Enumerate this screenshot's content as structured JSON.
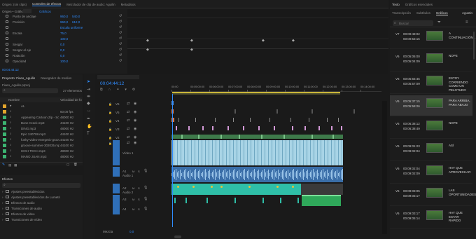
{
  "source_panel": {
    "tabs": [
      "Origen: (sin clips)",
      "Controles de efectos",
      "Mezclador de clip de audio: Aguilin",
      "Metadatos"
    ],
    "active_tab": "Controles de efectos",
    "header": "Origen • Gráficos",
    "subheader": "Gráficos",
    "properties": [
      {
        "name": "Punto de anclaje",
        "v1": "960,0",
        "v2": "540,0"
      },
      {
        "name": "Posición",
        "v1": "960,0",
        "v2": "612,0"
      },
      {
        "name": "",
        "v1": "Escala uniforme",
        "v2": ""
      },
      {
        "name": "Escala",
        "v1": "75,0",
        "v2": ""
      },
      {
        "name": "",
        "v1": "100,0",
        "v2": ""
      },
      {
        "name": "Sesgar",
        "v1": "0,0",
        "v2": ""
      },
      {
        "name": "Sesgar el eje",
        "v1": "0,0",
        "v2": ""
      },
      {
        "name": "Rotación",
        "v1": "0,0",
        "v2": ""
      },
      {
        "name": "Opacidad",
        "v1": "100,0",
        "v2": ""
      }
    ],
    "timecode": "00:04:44:12"
  },
  "project_panel": {
    "tabs": [
      "Proyecto: Fixeo_Aguilin",
      "Navegador de medios"
    ],
    "project_file": "Fixeo_Aguilin.prproj",
    "item_count": "27 elementos",
    "columns": [
      "Nombre",
      "Velocidad de fo"
    ],
    "items": [
      {
        "name": "AL",
        "rate": "",
        "color": "#e3a52c",
        "folder": true
      },
      {
        "name": "",
        "rate": "60,00 fps",
        "color": "#e3a52c"
      },
      {
        "name": "Appearing Cartoon Zip - Sc",
        "rate": "48000 Hz",
        "color": "#3cb371"
      },
      {
        "name": "Bone Crack.mp3",
        "rate": "44100 Hz",
        "color": "#3cb371"
      },
      {
        "name": "DING.mp3",
        "rate": "48000 Hz",
        "color": "#3cb371"
      },
      {
        "name": "Epic 240708.mp3",
        "rate": "44100 Hz",
        "color": "#3cb371"
      },
      {
        "name": "funky-video-energetic-groov",
        "rate": "44100 Hz",
        "color": "#3cb371"
      },
      {
        "name": "groove-summer-302035.mp",
        "rate": "44100 Hz",
        "color": "#3cb371"
      },
      {
        "name": "HIGH TECH.mp3",
        "rate": "48000 Hz",
        "color": "#3cb371"
      },
      {
        "name": "MANO JUAN.mp3",
        "rate": "48000 Hz",
        "color": "#3cb371"
      }
    ]
  },
  "effects_panel": {
    "title": "Efectos",
    "items": [
      "Ajustes preestablecidos",
      "Ajustes preestablecidos de Lumetri",
      "Efectos de audio",
      "Transiciones de audio",
      "Efectos de vídeo",
      "Transiciones de vídeo"
    ]
  },
  "timeline": {
    "timecode": "00:04:44:12",
    "ruler": [
      "00:00",
      "00:05:00:00",
      "00:06:00:00",
      "00:07:00:00",
      "00:08:00:00",
      "00:09:00:00",
      "00:10:00:00",
      "00:11:00:00",
      "00:12:00:00",
      "00:13:00:00",
      "00:14:00:00"
    ],
    "video_tracks": [
      "V6",
      "V5",
      "V4",
      "V3",
      "V2",
      "V1"
    ],
    "audio_tracks": [
      "A1",
      "A2",
      "A3",
      "A4"
    ],
    "v1_label": "Vídeo 1",
    "a1_label": "Audio 1",
    "a2_label": "Audio 2",
    "master_label": "Mezcla",
    "master_value": "0,0"
  },
  "right_panel": {
    "tabs": [
      "Texto",
      "Gráficos esenciales"
    ],
    "subtabs": [
      "Transcripción",
      "Subtítulos",
      "Gráficos"
    ],
    "active_subtab": "Gráficos",
    "track_button": "Agustin",
    "search_placeholder": "Buscar",
    "captions": [
      {
        "track": "V7",
        "start": "00:00:48:02",
        "end": "00:00:53:15",
        "text": "A CONTINUACIÓN..."
      },
      {
        "track": "V6",
        "start": "00:05:05:00",
        "end": "00:05:04:09",
        "text": "NOPE"
      },
      {
        "track": "V6",
        "start": "00:05:55:45",
        "end": "00:05:57:09",
        "text": "ESTOY CORRIENDO COMO UN PELOTUDO"
      },
      {
        "track": "V6",
        "start": "00:05:37:15",
        "end": "00:05:58:26",
        "text": "PARA ARRIBA, PARA ABAJO"
      },
      {
        "track": "V6",
        "start": "00:06:38:12",
        "end": "00:06:38:49",
        "text": "NOPE"
      },
      {
        "track": "V6",
        "start": "00:09:01:23",
        "end": "00:09:02:04",
        "text": "ASÍ"
      },
      {
        "track": "V6",
        "start": "00:09:02:04",
        "end": "00:09:02:09",
        "text": "HAY QUE APROVECHAR"
      },
      {
        "track": "V6",
        "start": "00:09:03:05",
        "end": "00:09:03:17",
        "text": "LAS OPORTUNIDADES"
      },
      {
        "track": "V6",
        "start": "00:09:03:17",
        "end": "00:09:05:14",
        "text": "HAY QUE ESTAR RÁPIDO"
      }
    ]
  }
}
